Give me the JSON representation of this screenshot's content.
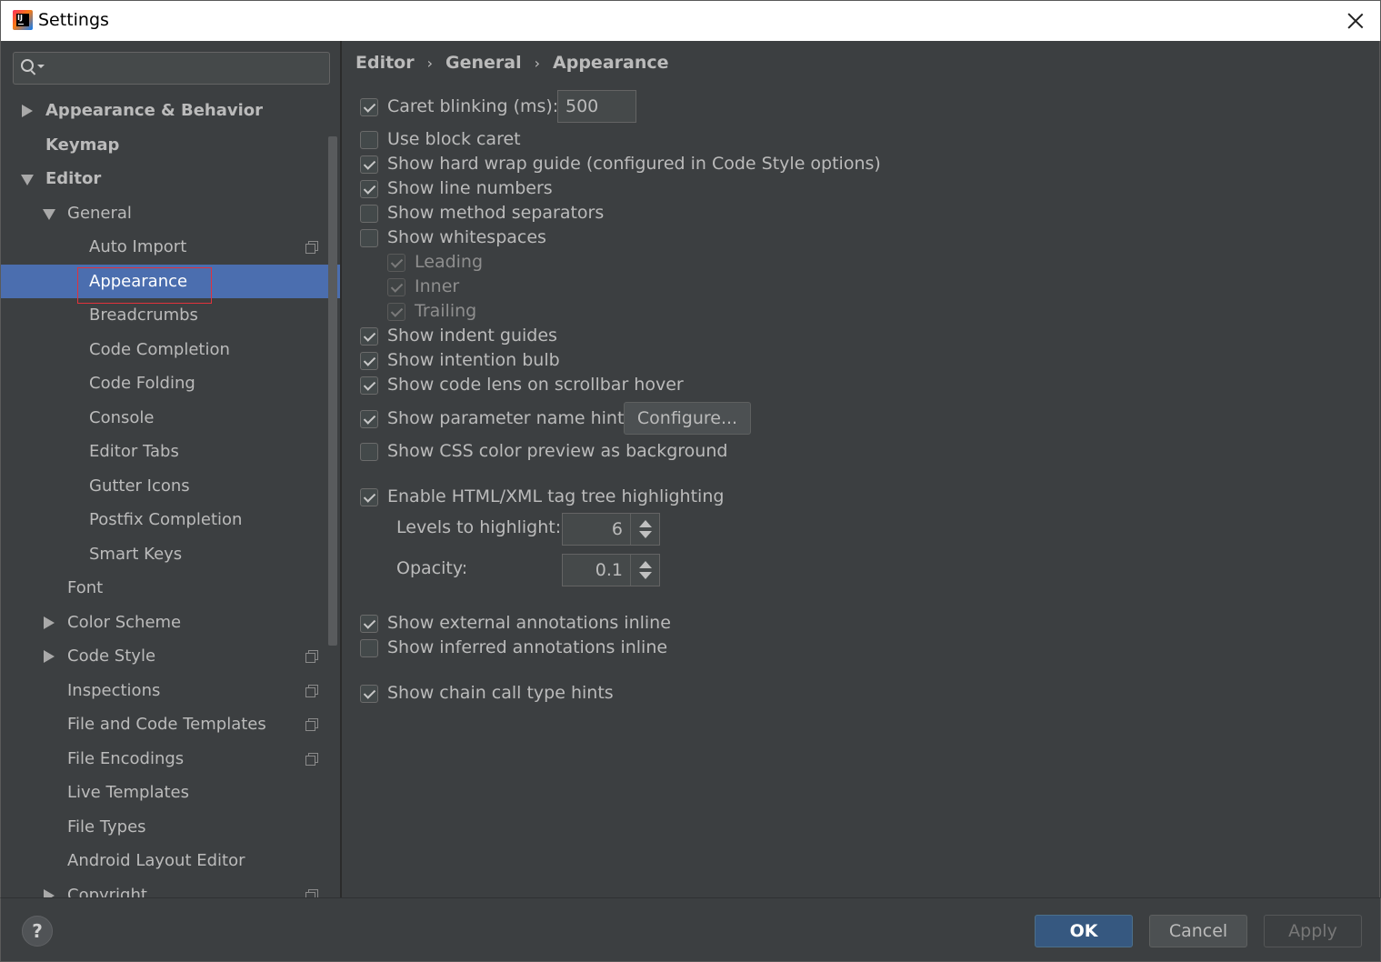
{
  "window": {
    "title": "Settings"
  },
  "search": {
    "placeholder": ""
  },
  "tree": [
    {
      "label": "Appearance & Behavior",
      "level": 0,
      "expander": "collapsed",
      "bold": true
    },
    {
      "label": "Keymap",
      "level": 0,
      "expander": "none",
      "bold": true
    },
    {
      "label": "Editor",
      "level": 0,
      "expander": "expanded",
      "bold": true
    },
    {
      "label": "General",
      "level": 1,
      "expander": "expanded"
    },
    {
      "label": "Auto Import",
      "level": 2,
      "copy": true
    },
    {
      "label": "Appearance",
      "level": 2,
      "selected": true
    },
    {
      "label": "Breadcrumbs",
      "level": 2
    },
    {
      "label": "Code Completion",
      "level": 2
    },
    {
      "label": "Code Folding",
      "level": 2
    },
    {
      "label": "Console",
      "level": 2
    },
    {
      "label": "Editor Tabs",
      "level": 2
    },
    {
      "label": "Gutter Icons",
      "level": 2
    },
    {
      "label": "Postfix Completion",
      "level": 2
    },
    {
      "label": "Smart Keys",
      "level": 2
    },
    {
      "label": "Font",
      "level": 1
    },
    {
      "label": "Color Scheme",
      "level": 1,
      "expander": "collapsed"
    },
    {
      "label": "Code Style",
      "level": 1,
      "expander": "collapsed",
      "copy": true
    },
    {
      "label": "Inspections",
      "level": 1,
      "copy": true
    },
    {
      "label": "File and Code Templates",
      "level": 1,
      "copy": true
    },
    {
      "label": "File Encodings",
      "level": 1,
      "copy": true
    },
    {
      "label": "Live Templates",
      "level": 1
    },
    {
      "label": "File Types",
      "level": 1
    },
    {
      "label": "Android Layout Editor",
      "level": 1
    },
    {
      "label": "Copyright",
      "level": 1,
      "expander": "collapsed",
      "copy": true
    }
  ],
  "breadcrumb": {
    "items": [
      "Editor",
      "General",
      "Appearance"
    ],
    "separator": "›"
  },
  "options": {
    "caret_blinking": {
      "label": "Caret blinking (ms):",
      "checked": true,
      "value": "500"
    },
    "block_caret": {
      "label": "Use block caret",
      "checked": false
    },
    "hard_wrap": {
      "label": "Show hard wrap guide (configured in Code Style options)",
      "checked": true
    },
    "line_numbers": {
      "label": "Show line numbers",
      "checked": true
    },
    "method_separators": {
      "label": "Show method separators",
      "checked": false
    },
    "whitespaces": {
      "label": "Show whitespaces",
      "checked": false
    },
    "leading": {
      "label": "Leading",
      "checked": true,
      "disabled": true
    },
    "inner": {
      "label": "Inner",
      "checked": true,
      "disabled": true
    },
    "trailing": {
      "label": "Trailing",
      "checked": true,
      "disabled": true
    },
    "indent_guides": {
      "label": "Show indent guides",
      "checked": true
    },
    "intention_bulb": {
      "label": "Show intention bulb",
      "checked": true
    },
    "code_lens": {
      "label": "Show code lens on scrollbar hover",
      "checked": true
    },
    "param_hints": {
      "label": "Show parameter name hints",
      "checked": true,
      "button": "Configure..."
    },
    "css_preview": {
      "label": "Show CSS color preview as background",
      "checked": false
    },
    "tag_tree": {
      "label": "Enable HTML/XML tag tree highlighting",
      "checked": true
    },
    "levels": {
      "label": "Levels to highlight:",
      "value": "6"
    },
    "opacity": {
      "label": "Opacity:",
      "value": "0.1"
    },
    "external_annotations": {
      "label": "Show external annotations inline",
      "checked": true
    },
    "inferred_annotations": {
      "label": "Show inferred annotations inline",
      "checked": false
    },
    "chain_hints": {
      "label": "Show chain call type hints",
      "checked": true
    }
  },
  "footer": {
    "help": "?",
    "ok": "OK",
    "cancel": "Cancel",
    "apply": "Apply"
  },
  "colors": {
    "selection": "#4b6eaf",
    "background": "#3c3f41",
    "ok_button": "#365880",
    "highlight_box": "#e0323c"
  }
}
